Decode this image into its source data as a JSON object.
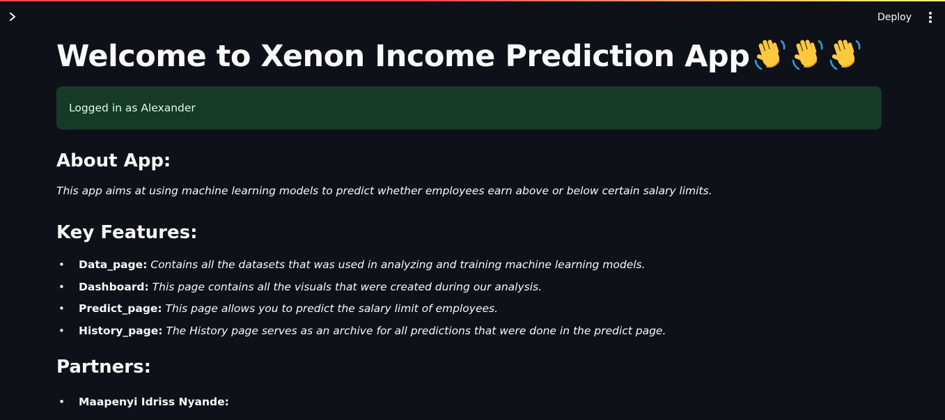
{
  "header": {
    "deploy_label": "Deploy"
  },
  "icons": {
    "sidebar_toggle": "chevron-right-icon",
    "menu": "kebab-menu-icon",
    "wave": "waving-hand-emoji"
  },
  "colors": {
    "background": "#0e1117",
    "success_bg": "#173928",
    "success_text": "#dffde9",
    "accent_red": "#ff4b4b"
  },
  "main": {
    "title": "Welcome to Xenon Income Prediction App",
    "login_message": "Logged in as Alexander",
    "about_heading": "About App:",
    "about_text": "This app aims at using machine learning models to predict whether employees earn above or below certain salary limits.",
    "features_heading": "Key Features:",
    "features": [
      {
        "name": "Data_page:",
        "description": "Contains all the datasets that was used in analyzing and training machine learning models."
      },
      {
        "name": "Dashboard:",
        "description": "This page contains all the visuals that were created during our analysis."
      },
      {
        "name": "Predict_page:",
        "description": "This page allows you to predict the salary limit of employees."
      },
      {
        "name": "History_page:",
        "description": "The History page serves as an archive for all predictions that were done in the predict page."
      }
    ],
    "partners_heading": "Partners:",
    "partners": [
      {
        "name": "Maapenyi Idriss Nyande:"
      }
    ]
  }
}
